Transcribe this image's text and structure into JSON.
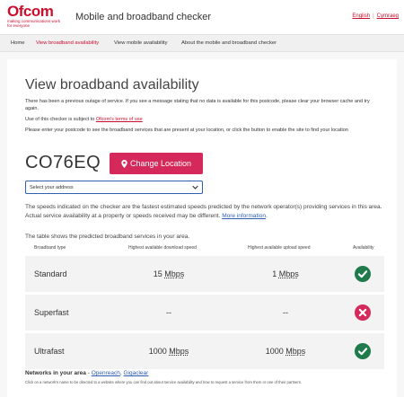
{
  "header": {
    "logo_text": "Ofcom",
    "logo_tagline_1": "making communications work",
    "logo_tagline_2": "for everyone",
    "app_title": "Mobile and broadband checker",
    "lang_english": "English",
    "lang_separator": "|",
    "lang_welsh": "Cymraeg"
  },
  "nav": {
    "items": [
      {
        "label": "Home",
        "active": false
      },
      {
        "label": "View broadband availability",
        "active": true
      },
      {
        "label": "View mobile availability",
        "active": false
      },
      {
        "label": "About the mobile and broadband checker",
        "active": false
      }
    ]
  },
  "main": {
    "title": "View broadband availability",
    "outage_notice": "There has been a previous outage of service. If you see a message stating that no data is available for this postcode, please clear your browser cache and try again.",
    "terms_prefix": "Use of this checker is subject to",
    "terms_link": "Ofcom's terms of use",
    "instructions": "Please enter your postcode to see the broadband services that are present at your location, or click the button to enable the site to find your location",
    "postcode": "CO76EQ",
    "change_location_label": "Change Location",
    "address_select_value": "Select your address",
    "speeds_text": "The speeds indicated on the checker are the fastest estimated speeds predicted by the network operator(s) providing services in this area. Actual service availability at a property or speeds received may be different.",
    "more_information_link": "More information",
    "speeds_text_end": ".",
    "table_intro": "The table shows the predicted broadband services in your area."
  },
  "table": {
    "headers": [
      "Broadband type",
      "Highest available download speed",
      "Highest available upload speed",
      "Availability"
    ],
    "rows": [
      {
        "type": "Standard",
        "download_value": "15",
        "download_unit": "Mbps",
        "upload_value": "1",
        "upload_unit": "Mbps",
        "available": true
      },
      {
        "type": "Superfast",
        "download_value": "--",
        "download_unit": "",
        "upload_value": "--",
        "upload_unit": "",
        "available": false
      },
      {
        "type": "Ultrafast",
        "download_value": "1000",
        "download_unit": "Mbps",
        "upload_value": "1000",
        "upload_unit": "Mbps",
        "available": true
      }
    ]
  },
  "networks": {
    "label": "Networks in your area",
    "dash": " - ",
    "providers": [
      "Openreach",
      "Gigaclear"
    ],
    "separator": ", ",
    "note": "Click on a network's name to be directed to a website where you can find out about service availability and how to request a service from them or one of their partners."
  },
  "colors": {
    "brand_red": "#c8102e",
    "button_pink": "#d6295b",
    "available_green": "#1f7a4c",
    "unavailable_pink": "#d6295b",
    "link_blue": "#2e5fb0"
  }
}
